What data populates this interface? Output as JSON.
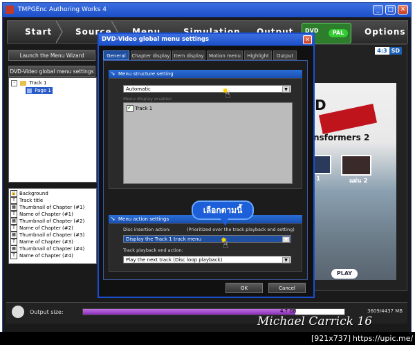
{
  "window": {
    "title": "TMPGEnc Authoring Works 4",
    "min": "_",
    "max": "□",
    "close": "✕"
  },
  "stages": [
    "Start",
    "Source",
    "Menu",
    "Simulation",
    "Output",
    "Options"
  ],
  "disc": {
    "type": "DVD",
    "format": "PAL"
  },
  "left_panel": {
    "wizard_button": "Launch the Menu Wizard",
    "global_button": "DVD-Video global menu settings",
    "tree": {
      "track": "Track 1",
      "page": "Page 1"
    },
    "layers": [
      "Background",
      "Track title",
      "Thumbnail of Chapter (#1)",
      "Name of Chapter (#1)",
      "Thumbnail of Chapter (#2)",
      "Name of Chapter (#2)",
      "Thumbnail of Chapter (#3)",
      "Name of Chapter (#3)",
      "Thumbnail of Chapter (#4)",
      "Name of Chapter (#4)"
    ]
  },
  "preview": {
    "ratio_a": "4:3",
    "ratio_b": "SD",
    "menu_text_top": "D",
    "menu_text_title": "nsformers 2",
    "menu_label_left": "1",
    "menu_label_right": "แผ่น 2",
    "menu_play": "PLAY"
  },
  "dialog": {
    "title": "DVD-Video global menu settings",
    "close": "✕",
    "tabs": [
      "General",
      "Chapter display",
      "Item display",
      "Motion menu",
      "Highlight",
      "Output"
    ],
    "structure": {
      "heading": "Menu structure setting",
      "selected": "Automatic",
      "display_enabler_label": "Menu display enabler:",
      "track_item": "Track 1"
    },
    "action": {
      "heading": "Menu action settings",
      "disc_insertion_label": "Disc insertion action:",
      "disc_insertion_note": "(Prioritized over the track playback end setting)",
      "disc_insertion_value": "Display the Track 1 track menu",
      "track_end_label": "Track playback end action:",
      "track_end_value": "Play the next track (Disc loop playback)"
    },
    "ok": "OK",
    "cancel": "Cancel"
  },
  "annotation": "เลือกตามนี้",
  "status": {
    "label": "Output size:",
    "size_label": "4.7 GB",
    "mb_label": "3609/4437 MB",
    "progress_fraction": 0.813
  },
  "watermark": "Michael Carrick 16",
  "footer": {
    "dims": "[921x737]",
    "url": "https://upic.me/"
  }
}
